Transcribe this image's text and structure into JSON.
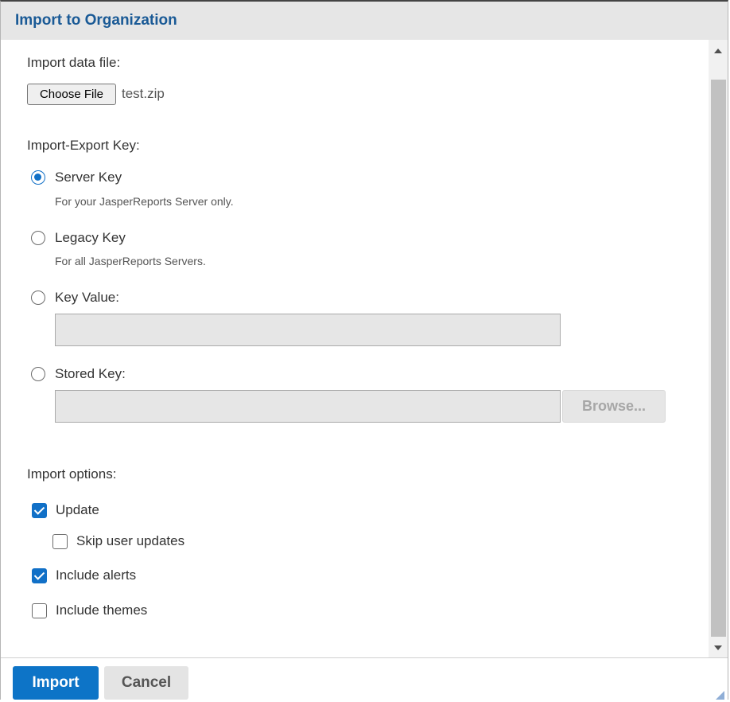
{
  "dialog": {
    "title": "Import to Organization"
  },
  "import_file": {
    "label": "Import data file:",
    "choose_button": "Choose File",
    "file_name": "test.zip"
  },
  "key_section": {
    "label": "Import-Export Key:",
    "options": [
      {
        "label": "Server Key",
        "hint": "For your JasperReports Server only.",
        "checked": true
      },
      {
        "label": "Legacy Key",
        "hint": "For all JasperReports Servers.",
        "checked": false
      },
      {
        "label": "Key Value:",
        "checked": false
      },
      {
        "label": "Stored Key:",
        "checked": false
      }
    ],
    "browse_button": "Browse..."
  },
  "import_options": {
    "label": "Import options:",
    "items": [
      {
        "label": "Update",
        "checked": true
      },
      {
        "label": "Skip user updates",
        "checked": false
      },
      {
        "label": "Include alerts",
        "checked": true
      },
      {
        "label": "Include themes",
        "checked": false
      }
    ]
  },
  "footer": {
    "import_button": "Import",
    "cancel_button": "Cancel"
  },
  "colors": {
    "accent": "#1170c7",
    "title": "#1a5a96",
    "primary_button": "#0d74c7"
  }
}
